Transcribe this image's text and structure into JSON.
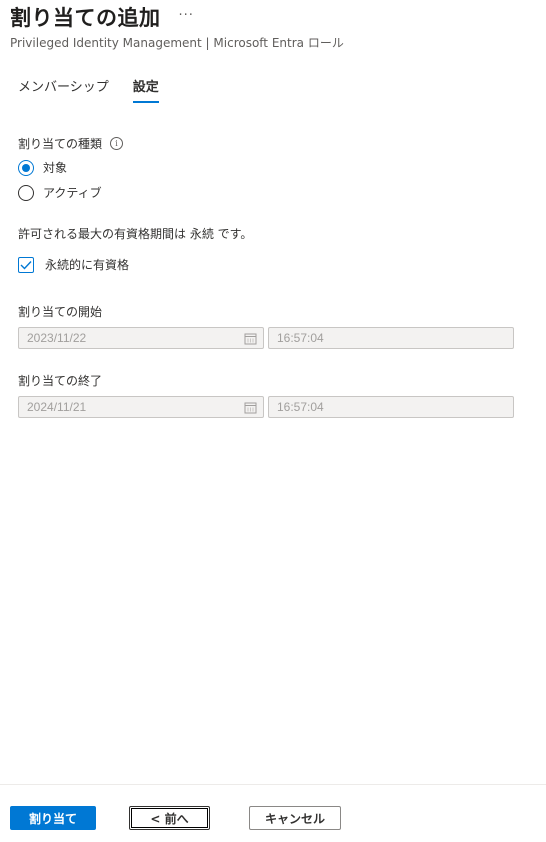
{
  "header": {
    "title": "割り当ての追加",
    "more_label": "···",
    "subtitle": "Privileged Identity Management | Microsoft Entra ロール"
  },
  "tabs": [
    {
      "label": "メンバーシップ",
      "active": false
    },
    {
      "label": "設定",
      "active": true
    }
  ],
  "assignment_type": {
    "label": "割り当ての種類",
    "info_icon": "i",
    "options": [
      {
        "label": "対象",
        "selected": true
      },
      {
        "label": "アクティブ",
        "selected": false
      }
    ]
  },
  "eligibility": {
    "info_text": "許可される最大の有資格期間は 永続 です。",
    "permanent_checkbox": {
      "label": "永続的に有資格",
      "checked": true
    }
  },
  "start": {
    "label": "割り当ての開始",
    "date": "2023/11/22",
    "time": "16:57:04"
  },
  "end": {
    "label": "割り当ての終了",
    "date": "2024/11/21",
    "time": "16:57:04"
  },
  "footer": {
    "assign_label": "割り当て",
    "prev_label": "< 前へ",
    "cancel_label": "キャンセル"
  },
  "colors": {
    "accent": "#0078d4",
    "disabled_bg": "#f3f2f1",
    "disabled_text": "#a19f9d"
  },
  "icons": {
    "calendar": "calendar-icon",
    "info": "info-icon",
    "check": "checkmark-icon"
  }
}
